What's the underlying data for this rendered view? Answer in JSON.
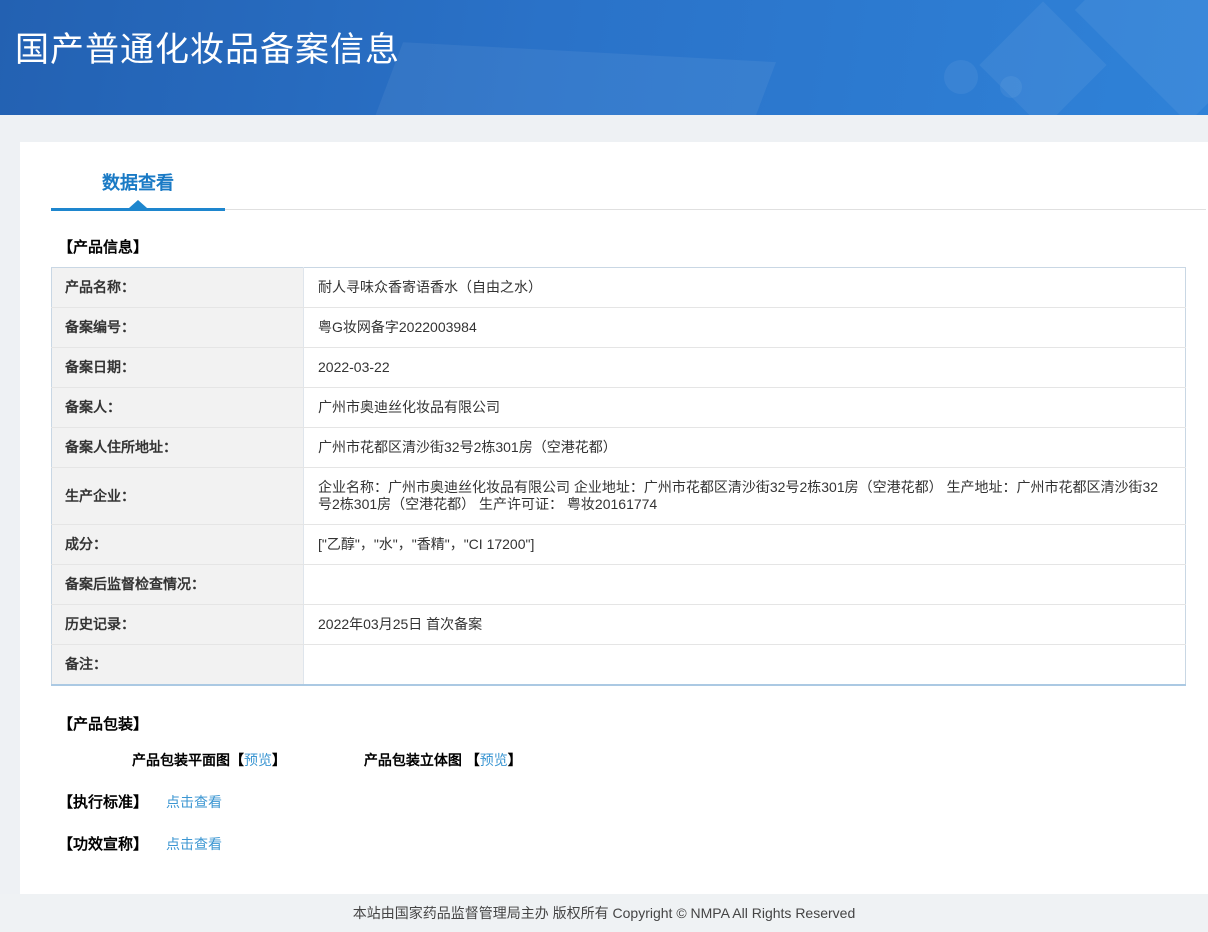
{
  "header": {
    "title": "国产普通化妆品备案信息"
  },
  "tabs": {
    "data_view": "数据查看"
  },
  "product_info": {
    "section_title": "【产品信息】",
    "rows": [
      {
        "label": "产品名称：",
        "value": "耐人寻味众香寄语香水（自由之水）"
      },
      {
        "label": "备案编号：",
        "value": "粤G妆网备字2022003984"
      },
      {
        "label": "备案日期：",
        "value": "2022-03-22"
      },
      {
        "label": "备案人：",
        "value": "广州市奥迪丝化妆品有限公司"
      },
      {
        "label": "备案人住所地址：",
        "value": "广州市花都区清沙街32号2栋301房（空港花都）"
      },
      {
        "label": "生产企业：",
        "value": "企业名称：广州市奥迪丝化妆品有限公司 企业地址：广州市花都区清沙街32号2栋301房（空港花都） 生产地址：广州市花都区清沙街32号2栋301房（空港花都） 生产许可证： 粤妆20161774"
      },
      {
        "label": "成分：",
        "value": "[\"乙醇\"，\"水\"，\"香精\"，\"CI 17200\"]"
      },
      {
        "label": "备案后监督检查情况：",
        "value": ""
      },
      {
        "label": "历史记录：",
        "value": "2022年03月25日 首次备案"
      },
      {
        "label": "备注：",
        "value": ""
      }
    ]
  },
  "packaging": {
    "section_title": "【产品包装】",
    "flat_label": "产品包装平面图",
    "stereo_label": "产品包装立体图",
    "bracket_open": "【",
    "bracket_close": "】",
    "preview_text": "预览"
  },
  "standards": {
    "label": "【执行标准】",
    "link": "点击查看"
  },
  "efficacy": {
    "label": "【功效宣称】",
    "link": "点击查看"
  },
  "footer": {
    "text": "本站由国家药品监督管理局主办 版权所有 Copyright © NMPA All Rights Reserved"
  },
  "colors": {
    "header_blue_start": "#2361b2",
    "header_blue_end": "#2f82d8",
    "accent_blue": "#1a7ac5",
    "link_blue": "#3b96d2",
    "table_border": "#c9d7e4",
    "label_cell_bg": "#f2f2f2"
  }
}
